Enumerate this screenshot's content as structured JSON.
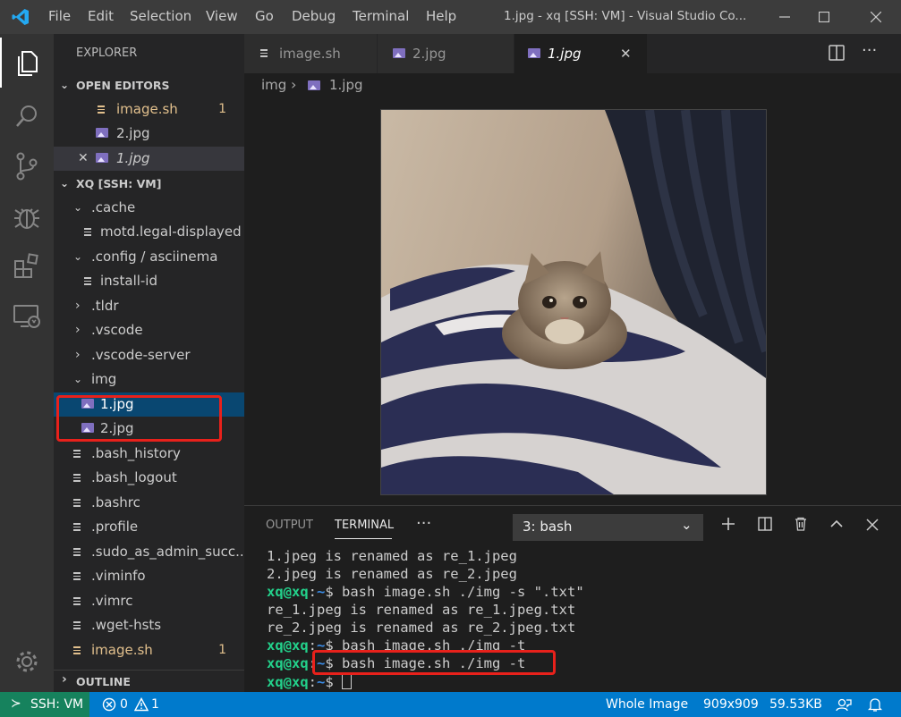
{
  "titlebar": {
    "menu": [
      "File",
      "Edit",
      "Selection",
      "View",
      "Go",
      "Debug",
      "Terminal",
      "Help"
    ],
    "window_title": "1.jpg - xq [SSH: VM] - Visual Studio Co..."
  },
  "sidebar": {
    "title": "EXPLORER",
    "open_editors_title": "OPEN EDITORS",
    "open_editors": [
      {
        "label": "image.sh",
        "badge": "1",
        "type": "file",
        "modified": true
      },
      {
        "label": "2.jpg",
        "type": "image"
      },
      {
        "label": "1.jpg",
        "type": "image",
        "active": true,
        "italic": true
      }
    ],
    "workspace_title": "XQ [SSH: VM]",
    "tree": [
      {
        "label": ".cache",
        "type": "folder",
        "open": true
      },
      {
        "label": "motd.legal-displayed",
        "type": "file"
      },
      {
        "label": ".config / asciinema",
        "type": "folder",
        "open": true
      },
      {
        "label": "install-id",
        "type": "file"
      },
      {
        "label": ".tldr",
        "type": "folder"
      },
      {
        "label": ".vscode",
        "type": "folder"
      },
      {
        "label": ".vscode-server",
        "type": "folder"
      },
      {
        "label": "img",
        "type": "folder",
        "open": true
      },
      {
        "label": "1.jpg",
        "type": "image",
        "selected": true
      },
      {
        "label": "2.jpg",
        "type": "image"
      },
      {
        "label": ".bash_history",
        "type": "file"
      },
      {
        "label": ".bash_logout",
        "type": "file"
      },
      {
        "label": ".bashrc",
        "type": "file"
      },
      {
        "label": ".profile",
        "type": "file"
      },
      {
        "label": ".sudo_as_admin_succ...",
        "type": "file"
      },
      {
        "label": ".viminfo",
        "type": "file"
      },
      {
        "label": ".vimrc",
        "type": "file"
      },
      {
        "label": ".wget-hsts",
        "type": "file"
      },
      {
        "label": "image.sh",
        "type": "file",
        "badge": "1",
        "modified": true
      }
    ],
    "outline_title": "OUTLINE"
  },
  "tabs": [
    {
      "label": "image.sh",
      "type": "file"
    },
    {
      "label": "2.jpg",
      "type": "image"
    },
    {
      "label": "1.jpg",
      "type": "image",
      "active": true
    }
  ],
  "breadcrumb": {
    "folder": "img",
    "file": "1.jpg"
  },
  "panel": {
    "tabs": [
      "OUTPUT",
      "TERMINAL"
    ],
    "active_tab": "TERMINAL",
    "terminal_select": "3: bash",
    "lines": [
      {
        "prompt": "",
        "text": "1.jpeg is renamed as re_1.jpeg"
      },
      {
        "prompt": "",
        "text": "2.jpeg is renamed as re_2.jpeg"
      },
      {
        "prompt": "xq@xq",
        "path": "~",
        "text": "$ bash image.sh ./img -s \".txt\""
      },
      {
        "prompt": "",
        "text": "re_1.jpeg is renamed as re_1.jpeg.txt"
      },
      {
        "prompt": "",
        "text": "re_2.jpeg is renamed as re_2.jpeg.txt"
      },
      {
        "prompt": "xq@xq",
        "path": "~",
        "text": "$ bash image.sh ./img -t"
      },
      {
        "prompt": "xq@xq",
        "path": "~",
        "text": "$ bash image.sh ./img -t"
      },
      {
        "prompt": "xq@xq",
        "path": "~",
        "text": "$ "
      }
    ]
  },
  "status": {
    "remote": "SSH: VM",
    "errors": "0",
    "warnings": "1",
    "view": "Whole Image",
    "dimensions": "909x909",
    "size": "59.53KB"
  },
  "colors": {
    "accent": "#007acc",
    "remote": "#16825d",
    "modified": "#e2c08d",
    "annotation": "#e8211b"
  }
}
